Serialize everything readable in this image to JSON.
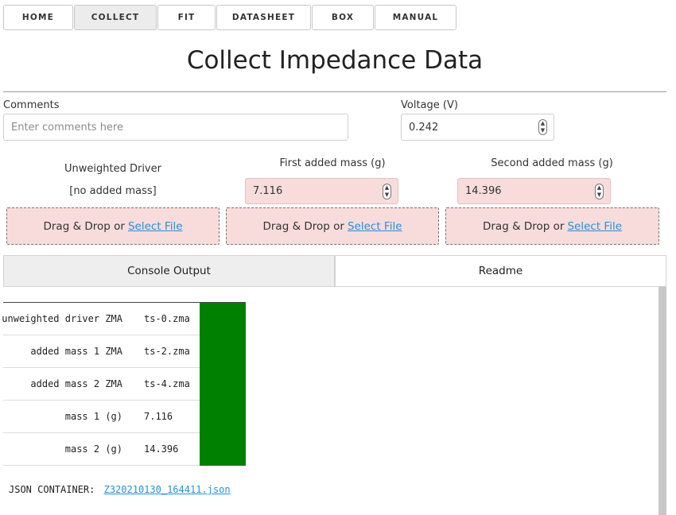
{
  "nav": {
    "items": [
      {
        "label": "HOME"
      },
      {
        "label": "COLLECT"
      },
      {
        "label": "FIT"
      },
      {
        "label": "DATASHEET"
      },
      {
        "label": "BOX"
      },
      {
        "label": "MANUAL"
      }
    ],
    "active": "COLLECT"
  },
  "page": {
    "title": "Collect Impedance Data"
  },
  "comments": {
    "label": "Comments",
    "placeholder": "Enter comments here",
    "value": ""
  },
  "voltage": {
    "label": "Voltage (V)",
    "value": "0.242"
  },
  "drivers": [
    {
      "heading": "Unweighted Driver",
      "subtext": "[no added mass]",
      "drop_text": "Drag & Drop or",
      "drop_link": "Select File"
    },
    {
      "heading": "First added mass (g)",
      "mass_value": "7.116",
      "drop_text": "Drag & Drop or",
      "drop_link": "Select File"
    },
    {
      "heading": "Second added mass (g)",
      "mass_value": "14.396",
      "drop_text": "Drag & Drop or",
      "drop_link": "Select File"
    }
  ],
  "tabs": [
    {
      "label": "Console Output"
    },
    {
      "label": "Readme"
    }
  ],
  "console": {
    "rows": [
      {
        "name": "unweighted driver ZMA",
        "value": "ts-0.zma",
        "status_color": "#008000"
      },
      {
        "name": "added mass 1 ZMA",
        "value": "ts-2.zma",
        "status_color": "#008000"
      },
      {
        "name": "added mass 2 ZMA",
        "value": "ts-4.zma",
        "status_color": "#008000"
      },
      {
        "name": "mass 1 (g)",
        "value": "7.116",
        "status_color": "#008000"
      },
      {
        "name": "mass 2 (g)",
        "value": "14.396",
        "status_color": "#008000"
      }
    ],
    "json_label": "JSON CONTAINER:",
    "json_file": "Z320210130_164411.json"
  },
  "colors": {
    "drop_bg": "#f8dcdc",
    "link": "#2a8fd4",
    "status_ok": "#008000"
  }
}
